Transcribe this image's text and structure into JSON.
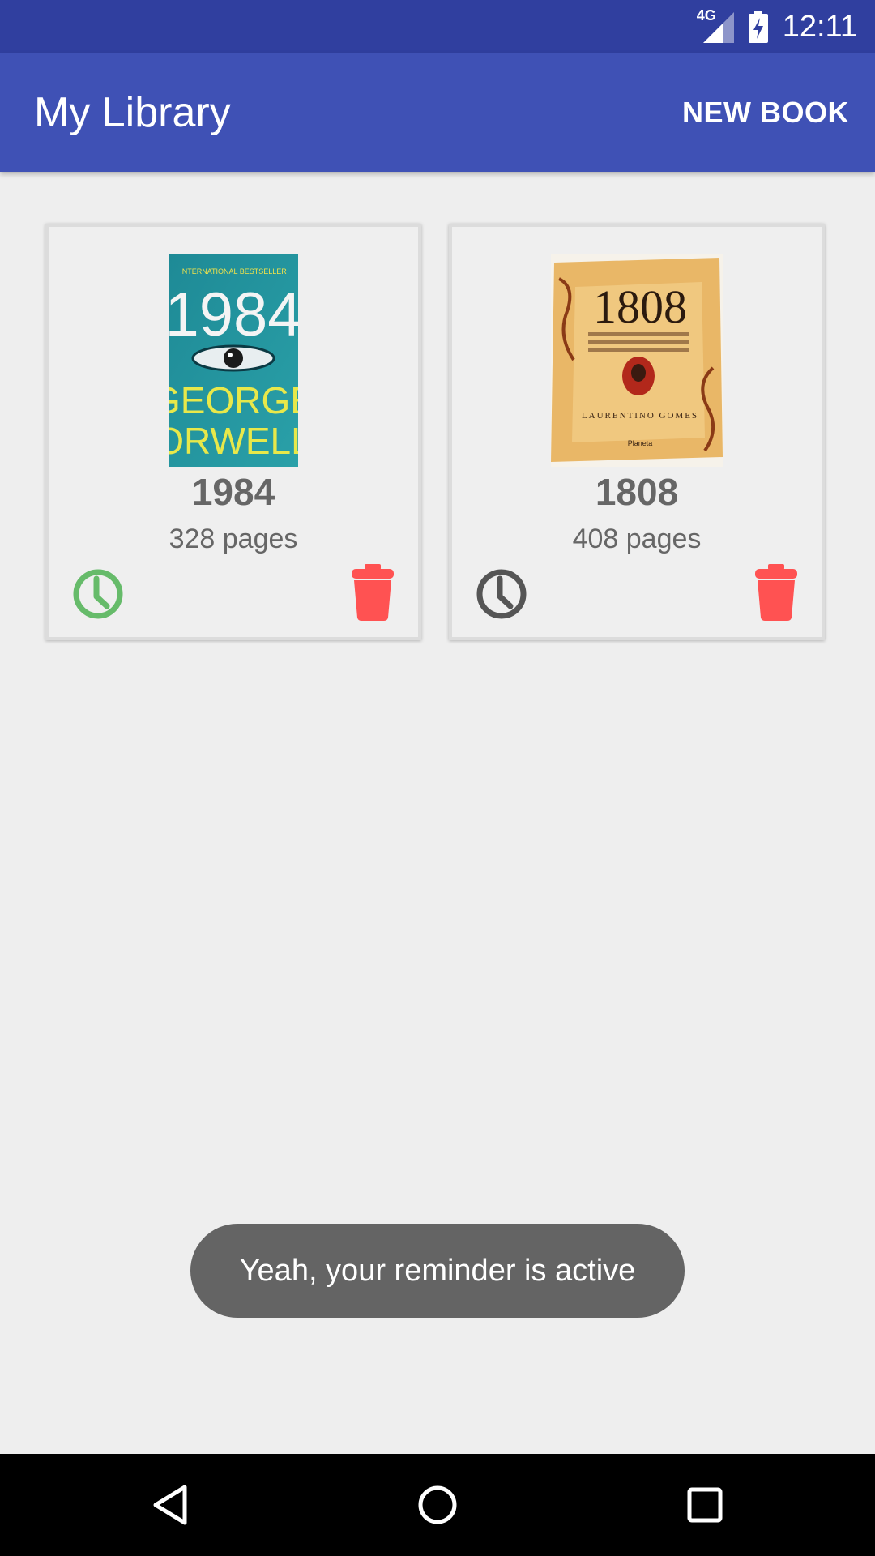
{
  "status_bar": {
    "network": "4G",
    "time": "12:11",
    "signal_icon": "signal-icon",
    "battery_icon": "battery-charging-icon"
  },
  "app_bar": {
    "title": "My Library",
    "action_label": "NEW BOOK"
  },
  "books": [
    {
      "title": "1984",
      "pages": "328 pages",
      "cover": {
        "top_text": "INTERNATIONAL BESTSELLER",
        "title": "1984",
        "author_line1": "GEORGE",
        "author_line2": "ORWELL"
      },
      "reminder_active": true,
      "reminder_color": "#66bb6a",
      "delete_color": "#ff5252"
    },
    {
      "title": "1808",
      "pages": "408 pages",
      "cover": {
        "title": "1808",
        "author": "LAURENTINO GOMES",
        "publisher": "Planeta"
      },
      "reminder_active": false,
      "reminder_color": "#555555",
      "delete_color": "#ff5252"
    }
  ],
  "toast": {
    "message": "Yeah, your reminder is active"
  },
  "nav_bar": {
    "back_icon": "back-icon",
    "home_icon": "home-icon",
    "recents_icon": "recents-icon"
  },
  "colors": {
    "primary": "#3f51b5",
    "primary_dark": "#303f9f",
    "background": "#eeeeee"
  }
}
